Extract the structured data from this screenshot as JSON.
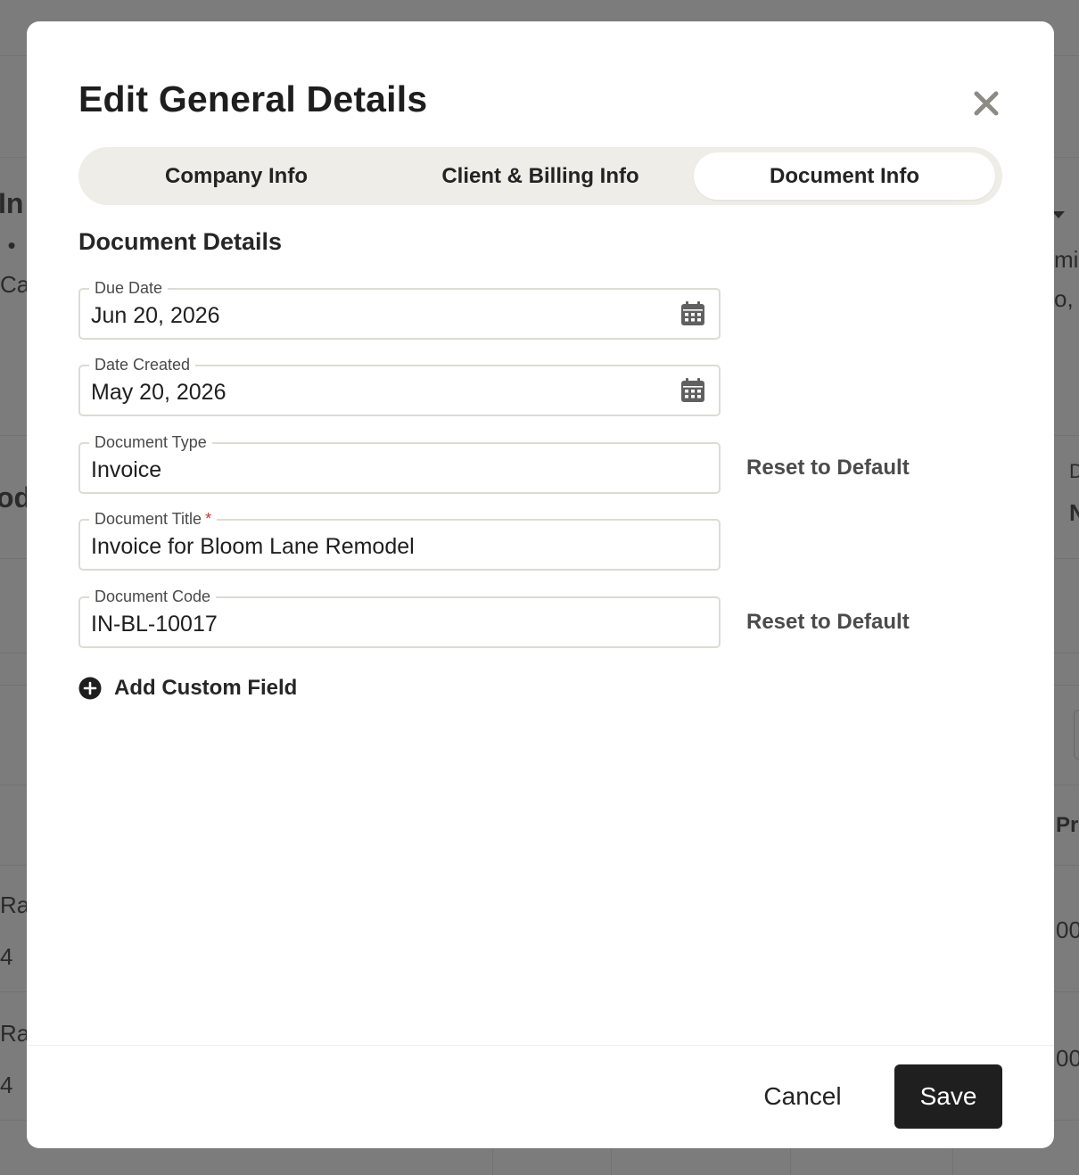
{
  "background": {
    "fragments": [
      {
        "text": "In",
        "style": "bold"
      },
      {
        "text": ": •",
        "style": "normal"
      },
      {
        "text": "Ca",
        "style": "normal"
      },
      {
        "text": "od",
        "style": "bold"
      },
      {
        "text": "Rat",
        "style": "normal"
      },
      {
        "text": "4",
        "style": "normal"
      },
      {
        "text": "Rat",
        "style": "normal"
      },
      {
        "text": "4",
        "style": "normal"
      },
      {
        "text": "mi",
        "style": "normal"
      },
      {
        "text": "o,",
        "style": "normal"
      },
      {
        "text": "D",
        "style": "normal"
      },
      {
        "text": "N",
        "style": "normal"
      },
      {
        "text": "Pr",
        "style": "normal"
      },
      {
        "text": "00",
        "style": "normal"
      },
      {
        "text": "00",
        "style": "normal"
      }
    ]
  },
  "modal": {
    "title": "Edit General Details",
    "close_icon": "close-icon",
    "tabs": [
      {
        "label": "Company Info",
        "active": false
      },
      {
        "label": "Client & Billing Info",
        "active": false
      },
      {
        "label": "Document Info",
        "active": true
      }
    ],
    "section_title": "Document Details",
    "fields": [
      {
        "label": "Due Date",
        "value": "Jun 20, 2026",
        "icon": "calendar-icon",
        "required": false
      },
      {
        "label": "Date Created",
        "value": "May 20, 2026",
        "icon": "calendar-icon",
        "required": false
      },
      {
        "label": "Document Type",
        "value": "Invoice",
        "required": false,
        "action": "Reset to Default"
      },
      {
        "label": "Document Title",
        "value": "Invoice for Bloom Lane Remodel",
        "required": true,
        "required_mark": "*"
      },
      {
        "label": "Document Code",
        "value": "IN-BL-10017",
        "required": false,
        "action": "Reset to Default"
      }
    ],
    "add_custom_field": {
      "label": "Add Custom Field",
      "icon": "plus-circle-icon"
    },
    "footer": {
      "cancel_label": "Cancel",
      "save_label": "Save"
    }
  },
  "colors": {
    "overlay": "#7c7c7c",
    "tab_track": "#eeede7",
    "field_border": "#dcdbd4",
    "required": "#c8372d",
    "primary_button": "#1f1f1f",
    "close_icon": "#8c8b84"
  }
}
